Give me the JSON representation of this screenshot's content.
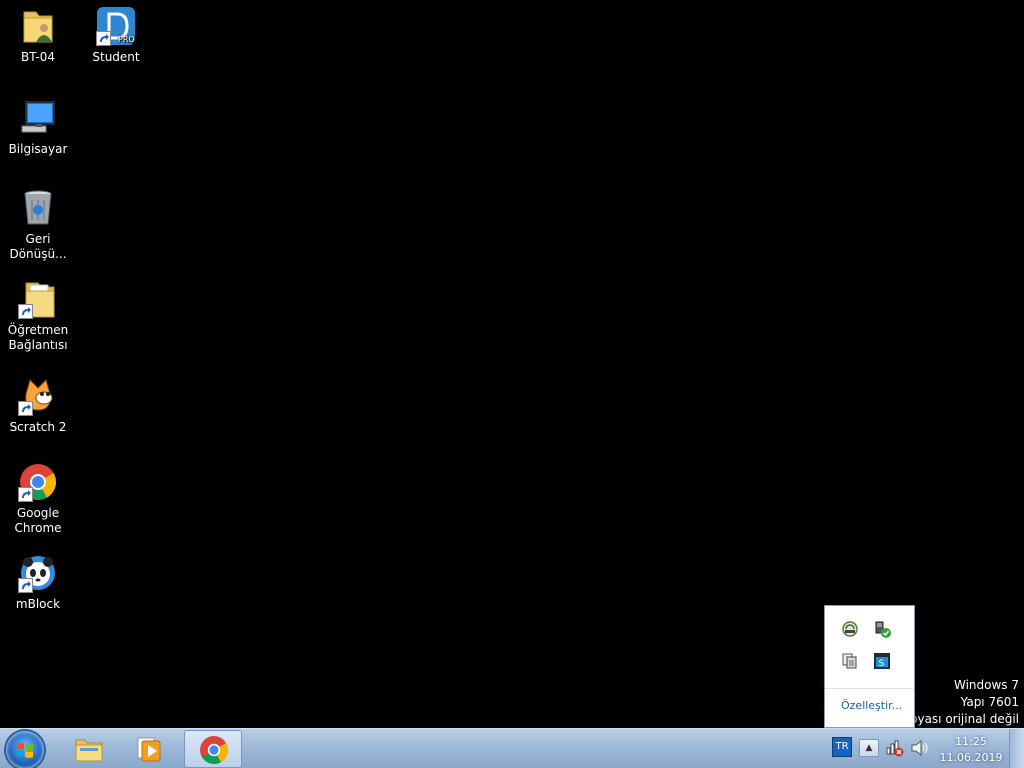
{
  "desktop": {
    "icons": [
      {
        "label": "BT-04",
        "icon": "user-folder-icon"
      },
      {
        "label": "Student",
        "icon": "student-app-icon"
      },
      {
        "label": "Bilgisayar",
        "icon": "computer-icon"
      },
      {
        "label": "Geri Dönüşü...",
        "icon": "recycle-bin-icon"
      },
      {
        "label": "Öğretmen Bağlantısı",
        "icon": "folder-shortcut-icon"
      },
      {
        "label": "Scratch 2",
        "icon": "scratch-cat-icon"
      },
      {
        "label": "Google Chrome",
        "icon": "chrome-icon"
      },
      {
        "label": "mBlock",
        "icon": "mblock-panda-icon"
      }
    ]
  },
  "watermark": {
    "line1": "Windows 7",
    "line2": "Yapı 7601",
    "line3": "copyası orijinal değil"
  },
  "tray_popup": {
    "customize_label": "Özelleştir..."
  },
  "taskbar": {
    "language": "TR",
    "time": "11:25",
    "date": "11.06.2019"
  }
}
